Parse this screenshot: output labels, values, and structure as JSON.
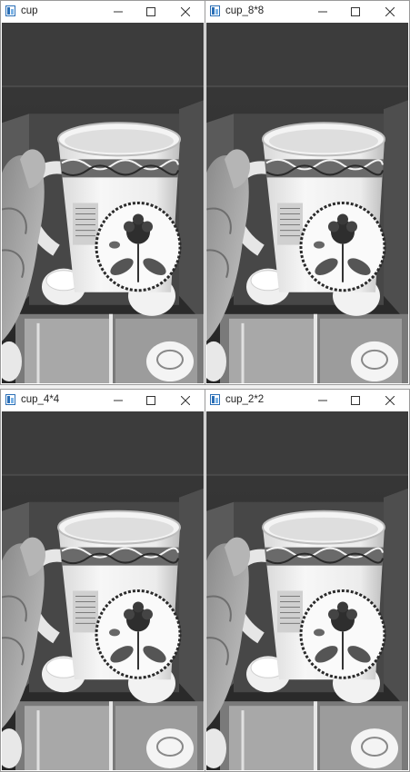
{
  "windows": [
    {
      "id": "cup",
      "title": "cup",
      "icons": {
        "app": "opencv-window-icon",
        "minimize": "minimize-icon",
        "maximize": "maximize-icon",
        "close": "close-icon"
      }
    },
    {
      "id": "cup_8x8",
      "title": "cup_8*8",
      "icons": {
        "app": "opencv-window-icon",
        "minimize": "minimize-icon",
        "maximize": "maximize-icon",
        "close": "close-icon"
      }
    },
    {
      "id": "cup_4x4",
      "title": "cup_4*4",
      "icons": {
        "app": "opencv-window-icon",
        "minimize": "minimize-icon",
        "maximize": "maximize-icon",
        "close": "close-icon"
      }
    },
    {
      "id": "cup_2x2",
      "title": "cup_2*2",
      "icons": {
        "app": "opencv-window-icon",
        "minimize": "minimize-icon",
        "maximize": "maximize-icon",
        "close": "close-icon"
      }
    }
  ],
  "colors": {
    "window_border": "#9a9a9a",
    "titlebar": "#ffffff",
    "desktop": "#f0f0f0",
    "icon_blue": "#2b6fb6"
  }
}
